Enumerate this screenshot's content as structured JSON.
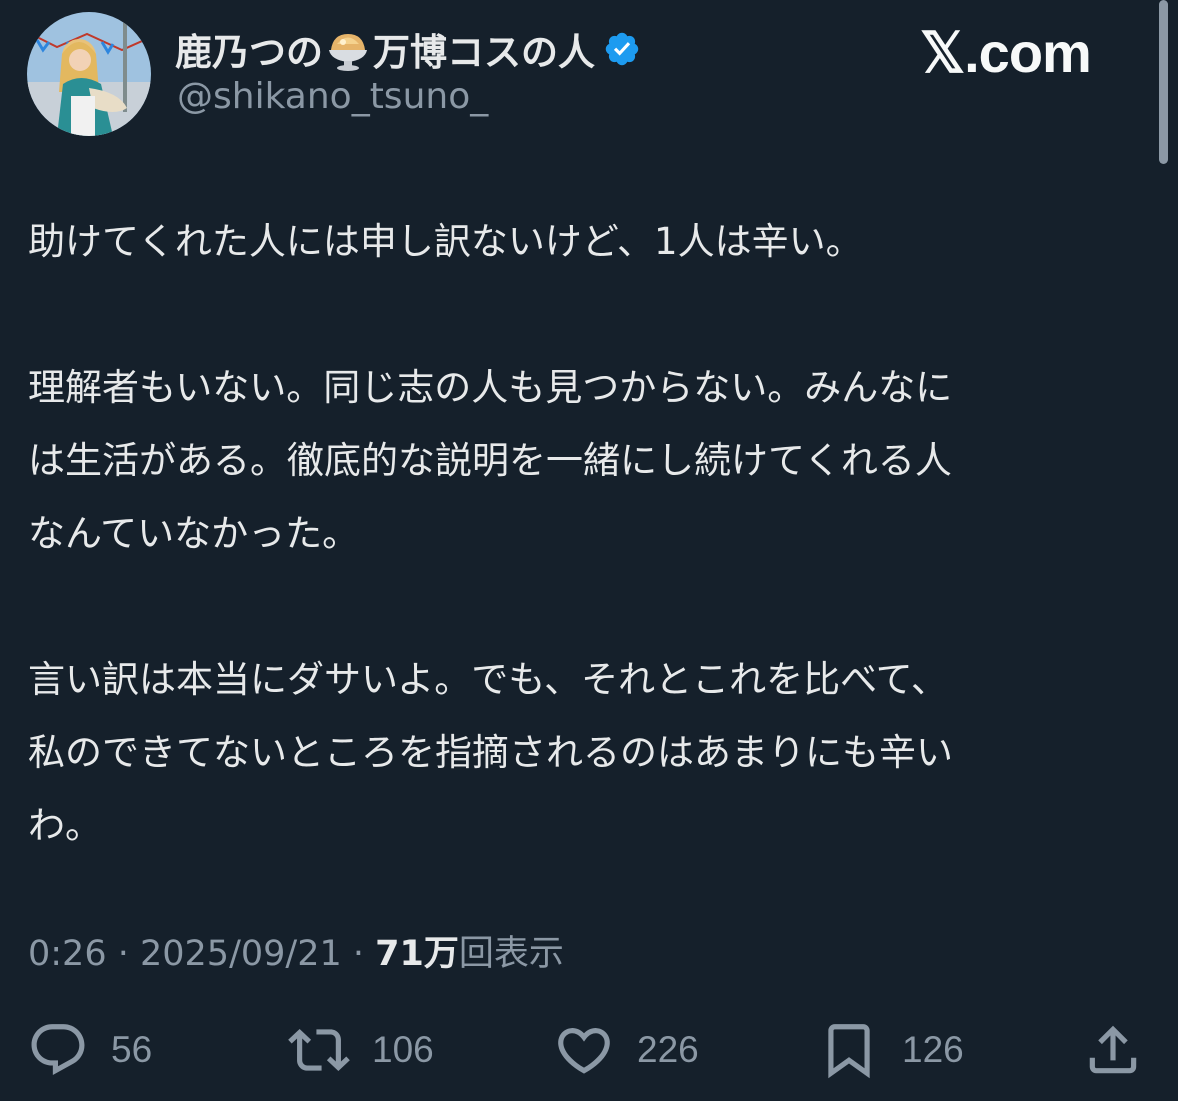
{
  "header": {
    "display_name_part1": "鹿乃つの",
    "display_name_part2": "万博コスの人",
    "emoji_icon": "shaved-ice-icon",
    "verified_icon": "verified-badge-icon",
    "handle": "@shikano_tsuno_",
    "brand": "𝕏.com"
  },
  "tweet": {
    "paragraphs": [
      [
        "助けてくれた人には申し訳ないけど、1人は辛い。"
      ],
      [
        "理解者もいない。同じ志の人も見つからない。みんなに",
        "は生活がある。徹底的な説明を一緒にし続けてくれる人",
        "なんていなかった。"
      ],
      [
        "言い訳は本当にダサいよ。でも、それとこれを比べて、",
        "私のできてないところを指摘されるのはあまりにも辛い",
        "わ。"
      ]
    ]
  },
  "meta": {
    "time": "0:26",
    "separator": " · ",
    "date": "2025/09/21",
    "views_count": "71万",
    "views_label": "回表示"
  },
  "actions": {
    "reply": {
      "icon": "reply-icon",
      "count": "56"
    },
    "retweet": {
      "icon": "retweet-icon",
      "count": "106"
    },
    "like": {
      "icon": "heart-icon",
      "count": "226"
    },
    "bookmark": {
      "icon": "bookmark-icon",
      "count": "126"
    },
    "share": {
      "icon": "share-icon"
    }
  },
  "colors": {
    "background": "#15202b",
    "text": "#e7e9ea",
    "muted": "#8b98a5",
    "verified": "#1d9bf0"
  }
}
